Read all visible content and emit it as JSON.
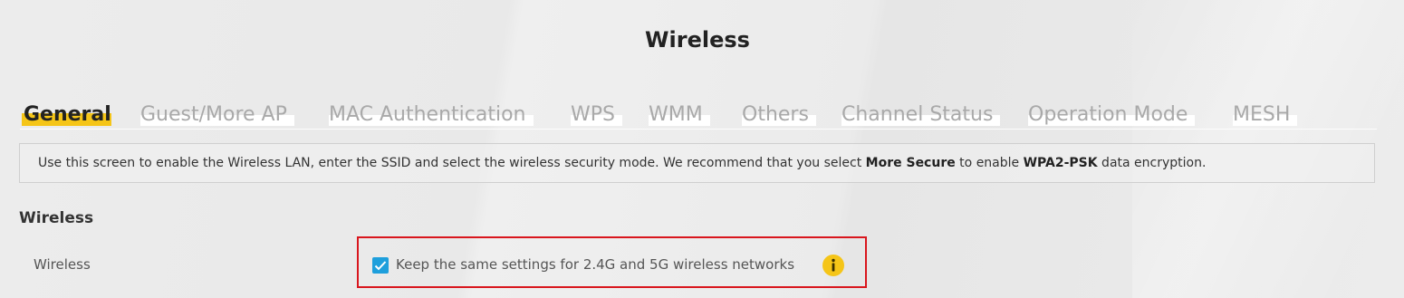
{
  "page": {
    "title": "Wireless"
  },
  "tabs": [
    {
      "label": "General",
      "active": true
    },
    {
      "label": "Guest/More AP",
      "active": false
    },
    {
      "label": "MAC Authentication",
      "active": false
    },
    {
      "label": "WPS",
      "active": false
    },
    {
      "label": "WMM",
      "active": false
    },
    {
      "label": "Others",
      "active": false
    },
    {
      "label": "Channel Status",
      "active": false
    },
    {
      "label": "Operation Mode",
      "active": false
    },
    {
      "label": "MESH",
      "active": false
    }
  ],
  "info": {
    "part1": "Use this screen to enable the Wireless LAN, enter the SSID and select the wireless security mode. We recommend that you select ",
    "bold1": "More Secure",
    "part2": " to enable ",
    "bold2": "WPA2-PSK",
    "part3": " data encryption."
  },
  "section": {
    "heading": "Wireless",
    "row_label": "Wireless",
    "checkbox_label": "Keep the same settings for 2.4G and 5G wireless networks",
    "checkbox_checked": true
  },
  "colors": {
    "accent_yellow": "#f5c518",
    "checkbox_blue": "#1e9fdc",
    "highlight_red": "#d9161d"
  },
  "icons": {
    "checkbox": "check-icon",
    "info": "info-icon"
  }
}
